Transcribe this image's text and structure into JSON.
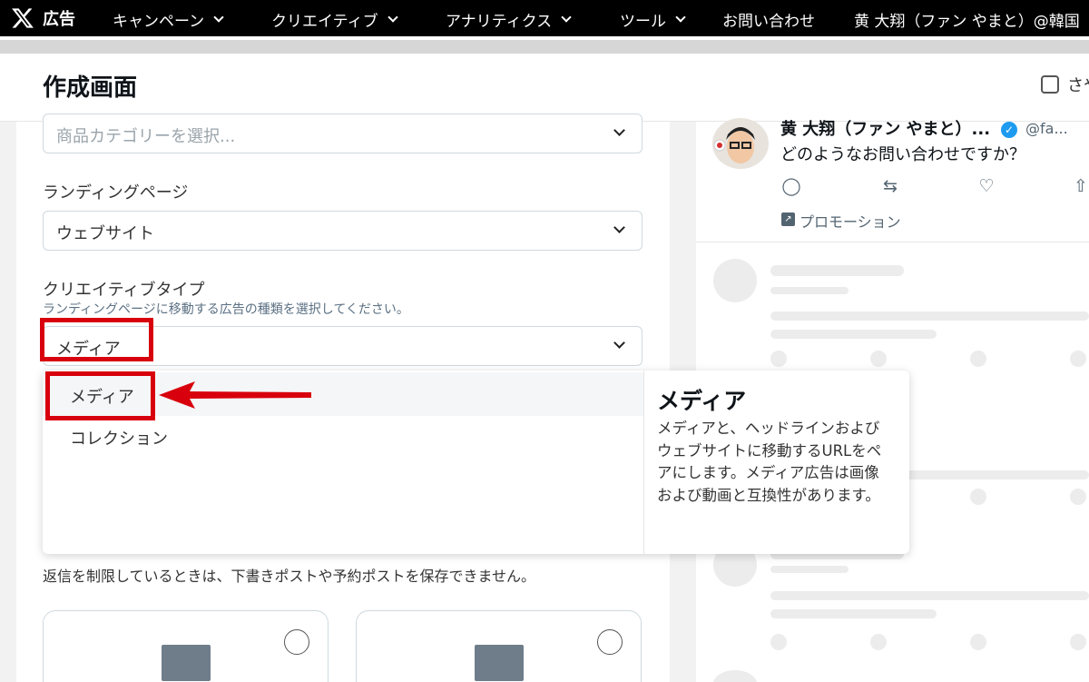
{
  "nav": {
    "brand": "広告",
    "items": [
      "キャンペーン",
      "クリエイティブ",
      "アナリティクス",
      "ツール"
    ],
    "help": "お問い合わせ",
    "account": "黄 大翔（ファン やまと）@韓国"
  },
  "header": {
    "title": "作成画面",
    "checkbox_label": "さや"
  },
  "form": {
    "category_placeholder": "商品カテゴリーを選択...",
    "landing_label": "ランディングページ",
    "landing_value": "ウェブサイト",
    "creative_label": "クリエイティブタイプ",
    "creative_help": "ランディングページに移動する広告の種類を選択してください。",
    "creative_value": "メディア",
    "reply_note": "返信を制限しているときは、下書きポストや予約ポストを保存できません。"
  },
  "dropdown": {
    "options": [
      "メディア",
      "コレクション"
    ],
    "desc_title": "メディア",
    "desc_body": "メディアと、ヘッドラインおよびウェブサイトに移動するURLをペアにします。メディア広告は画像および動画と互換性があります。"
  },
  "preview": {
    "name": "黄 大翔（ファン やまと）...",
    "handle": "@fa...",
    "text": "どのようなお問い合わせですか？",
    "promo": "プロモーション"
  },
  "colors": {
    "accent_red": "#d8000c",
    "verified": "#1d9bf0"
  }
}
